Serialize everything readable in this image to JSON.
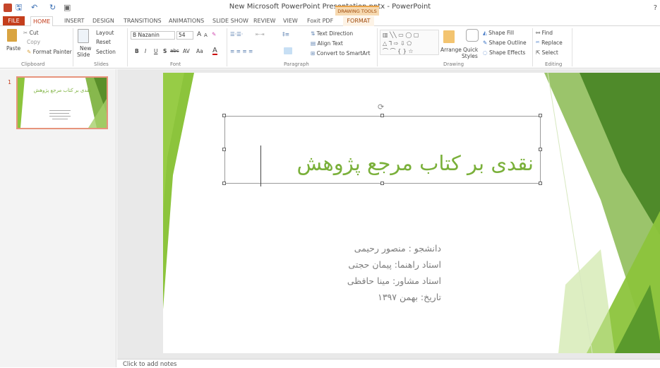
{
  "window": {
    "title": "New Microsoft PowerPoint Presentation.pptx - PowerPoint",
    "help": "?"
  },
  "quick_access": {
    "save": "🖫",
    "undo": "↶",
    "redo": "↻",
    "present": "▣"
  },
  "contextual_tab": {
    "group": "DRAWING TOOLS"
  },
  "tabs": [
    "FILE",
    "HOME",
    "INSERT",
    "DESIGN",
    "TRANSITIONS",
    "ANIMATIONS",
    "SLIDE SHOW",
    "REVIEW",
    "VIEW",
    "Foxit PDF",
    "FORMAT"
  ],
  "ribbon": {
    "clipboard": {
      "paste": "Paste",
      "cut": "Cut",
      "copy": "Copy",
      "format_painter": "Format Painter",
      "label": "Clipboard"
    },
    "slides": {
      "new_slide": "New",
      "new_slide2": "Slide",
      "layout": "Layout",
      "reset": "Reset",
      "section": "Section",
      "label": "Slides"
    },
    "font": {
      "family": "B Nazanin",
      "size": "54",
      "bold": "B",
      "italic": "I",
      "underline": "U",
      "shadow": "S",
      "strike": "abc",
      "spacing": "AV",
      "case": "Aa",
      "color": "A",
      "grow": "A",
      "shrink": "A",
      "label": "Font"
    },
    "paragraph": {
      "text_direction": "Text Direction",
      "align_text": "Align Text",
      "smartart": "Convert to SmartArt",
      "label": "Paragraph"
    },
    "drawing": {
      "arrange": "Arrange",
      "quick_styles": "Quick",
      "quick_styles2": "Styles",
      "shape_fill": "Shape Fill",
      "shape_outline": "Shape Outline",
      "shape_effects": "Shape Effects",
      "label": "Drawing"
    },
    "editing": {
      "find": "Find",
      "replace": "Replace",
      "select": "Select",
      "label": "Editing"
    }
  },
  "thumbnail": {
    "number": "1",
    "title": "نقدی بر کتاب مرجع پژوهش"
  },
  "slide": {
    "title": "نقدی بر کتاب مرجع پژوهش",
    "subtitle_lines": [
      "دانشجو : منصور رحیمی",
      "استاد راهنما: پیمان حجتی",
      "استاد مشاور: مینا حافظی",
      "تاریخ: بهمن ۱۳۹۷"
    ]
  },
  "notes": {
    "placeholder": "Click to add notes"
  },
  "colors": {
    "accent": "#c43e1c",
    "green": "#7ab03a",
    "contextual": "#f6d9b0"
  }
}
